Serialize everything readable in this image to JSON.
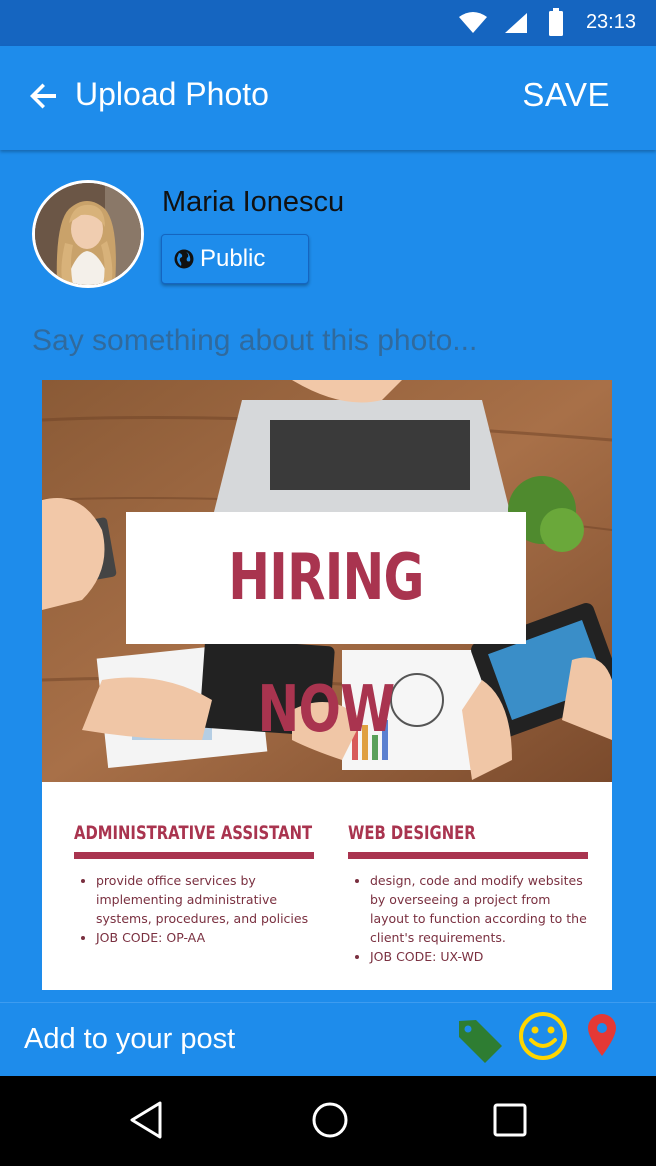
{
  "status_bar": {
    "time": "23:13",
    "icons": [
      "wifi-icon",
      "signal-icon",
      "battery-icon"
    ]
  },
  "app_bar": {
    "title": "Upload Photo",
    "save_label": "SAVE",
    "back_icon": "arrow-left-icon"
  },
  "user": {
    "name": "Maria Ionescu",
    "privacy_label": "Public",
    "privacy_icon": "globe-icon"
  },
  "caption": {
    "placeholder": "Say something about this photo...",
    "value": ""
  },
  "photo": {
    "headline": "HIRING NOW",
    "jobs": [
      {
        "title": "ADMINISTRATIVE ASSISTANT",
        "bullets": [
          "provide office services by implementing administrative systems, procedures, and policies",
          "JOB CODE: OP-AA"
        ]
      },
      {
        "title": "WEB DESIGNER",
        "bullets": [
          "design, code and modify websites by overseeing a project from layout to function according to the client's requirements.",
          "JOB CODE: UX-WD"
        ]
      }
    ]
  },
  "bottom_bar": {
    "label": "Add to your post",
    "icons": [
      "tag-icon",
      "smiley-icon",
      "location-pin-icon"
    ]
  },
  "nav_bar": {
    "icons": [
      "back-triangle-icon",
      "home-circle-icon",
      "recents-square-icon"
    ]
  },
  "colors": {
    "primary": "#1E8CEB",
    "status_bar": "#1565C0",
    "accent_text": "#A9344F",
    "tag": "#2E7D32",
    "smiley": "#FFD600",
    "pin": "#E53935"
  }
}
